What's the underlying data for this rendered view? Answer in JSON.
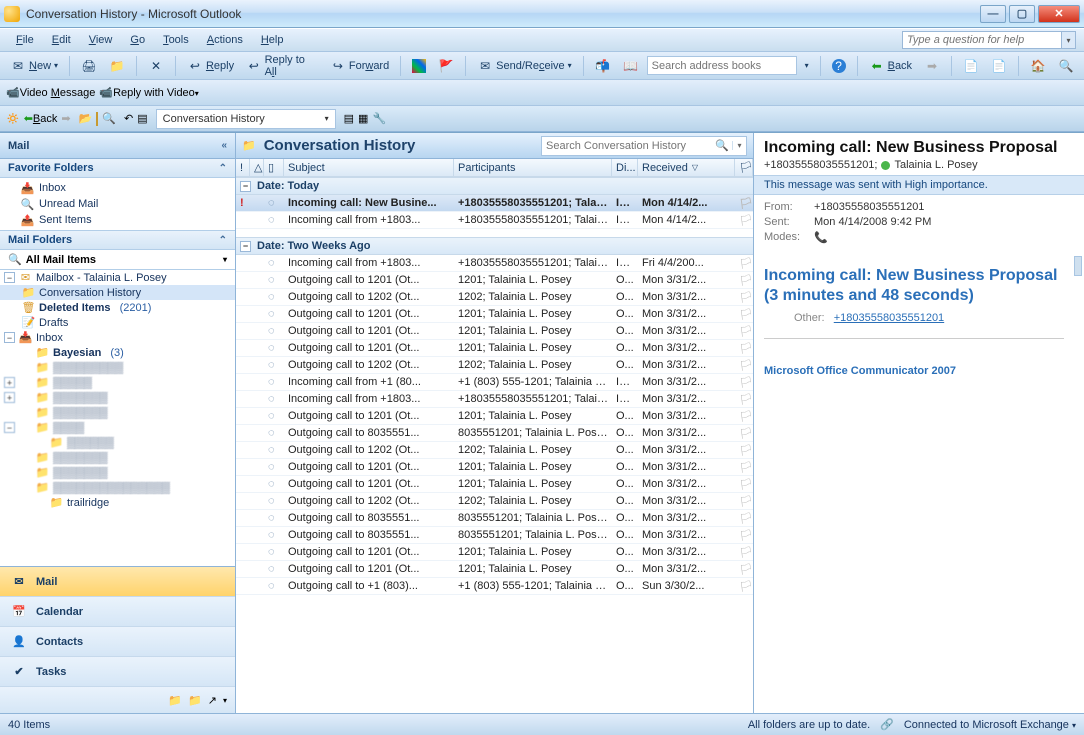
{
  "window": {
    "title": "Conversation History - Microsoft Outlook"
  },
  "menu": {
    "file": "File",
    "edit": "Edit",
    "view": "View",
    "go": "Go",
    "tools": "Tools",
    "actions": "Actions",
    "help": "Help",
    "help_placeholder": "Type a question for help"
  },
  "tb1": {
    "new": "New",
    "reply": "Reply",
    "reply_all": "Reply to All",
    "forward": "Forward",
    "sendrecv": "Send/Receive",
    "search_placeholder": "Search address books",
    "back": "Back"
  },
  "tb2": {
    "video_msg": "Video Message",
    "reply_video": "Reply with Video"
  },
  "tb3": {
    "back": "Back",
    "folder": "Conversation History"
  },
  "nav": {
    "header": "Mail",
    "fav_header": "Favorite Folders",
    "favorites": [
      {
        "label": "Inbox",
        "icon": "inbox"
      },
      {
        "label": "Unread Mail",
        "icon": "search"
      },
      {
        "label": "Sent Items",
        "icon": "sent"
      }
    ],
    "mail_header": "Mail Folders",
    "all_mail": "All Mail Items",
    "mailbox_root": "Mailbox - Talainia L. Posey",
    "conv_hist": "Conversation History",
    "deleted": "Deleted Items",
    "deleted_count": "(2201)",
    "drafts": "Drafts",
    "inbox": "Inbox",
    "bayesian": "Bayesian",
    "bayesian_count": "(3)",
    "trailridge": "trailridge",
    "big": {
      "mail": "Mail",
      "calendar": "Calendar",
      "contacts": "Contacts",
      "tasks": "Tasks"
    }
  },
  "list": {
    "folder_title": "Conversation History",
    "search_placeholder": "Search Conversation History",
    "cols": {
      "subject": "Subject",
      "participants": "Participants",
      "di": "Di...",
      "received": "Received"
    },
    "group_today": "Date: Today",
    "group_twoweeks": "Date: Two Weeks Ago",
    "rows_today": [
      {
        "imp": true,
        "subject": "Incoming call: New Busine...",
        "participants": "+18035558035551201; Talaini...",
        "dir": "In...",
        "received": "Mon 4/14/2...",
        "selected": true,
        "unread": true
      },
      {
        "subject": "Incoming call from +1803...",
        "participants": "+18035558035551201; Talaini...",
        "dir": "In...",
        "received": "Mon 4/14/2..."
      }
    ],
    "rows_twoweeks": [
      {
        "subject": "Incoming call from +1803...",
        "participants": "+18035558035551201; Talaini...",
        "dir": "In...",
        "received": "Fri 4/4/200..."
      },
      {
        "subject": "Outgoing call to 1201 (Ot...",
        "participants": "1201; Talainia L. Posey",
        "dir": "O...",
        "received": "Mon 3/31/2..."
      },
      {
        "subject": "Outgoing call to 1202 (Ot...",
        "participants": "1202; Talainia L. Posey",
        "dir": "O...",
        "received": "Mon 3/31/2..."
      },
      {
        "subject": "Outgoing call to 1201 (Ot...",
        "participants": "1201; Talainia L. Posey",
        "dir": "O...",
        "received": "Mon 3/31/2..."
      },
      {
        "subject": "Outgoing call to 1201 (Ot...",
        "participants": "1201; Talainia L. Posey",
        "dir": "O...",
        "received": "Mon 3/31/2..."
      },
      {
        "subject": "Outgoing call to 1201 (Ot...",
        "participants": "1201; Talainia L. Posey",
        "dir": "O...",
        "received": "Mon 3/31/2..."
      },
      {
        "subject": "Outgoing call to 1202 (Ot...",
        "participants": "1202; Talainia L. Posey",
        "dir": "O...",
        "received": "Mon 3/31/2..."
      },
      {
        "subject": "Incoming call from +1 (80...",
        "participants": "+1 (803) 555-1201; Talainia L...",
        "dir": "In...",
        "received": "Mon 3/31/2..."
      },
      {
        "subject": "Incoming call from +1803...",
        "participants": "+18035558035551201; Talaini...",
        "dir": "In...",
        "received": "Mon 3/31/2..."
      },
      {
        "subject": "Outgoing call to 1201 (Ot...",
        "participants": "1201; Talainia L. Posey",
        "dir": "O...",
        "received": "Mon 3/31/2..."
      },
      {
        "subject": "Outgoing call to 8035551...",
        "participants": "8035551201; Talainia L. Posey",
        "dir": "O...",
        "received": "Mon 3/31/2..."
      },
      {
        "subject": "Outgoing call to 1202 (Ot...",
        "participants": "1202; Talainia L. Posey",
        "dir": "O...",
        "received": "Mon 3/31/2..."
      },
      {
        "subject": "Outgoing call to 1201 (Ot...",
        "participants": "1201; Talainia L. Posey",
        "dir": "O...",
        "received": "Mon 3/31/2..."
      },
      {
        "subject": "Outgoing call to 1201 (Ot...",
        "participants": "1201; Talainia L. Posey",
        "dir": "O...",
        "received": "Mon 3/31/2..."
      },
      {
        "subject": "Outgoing call to 1202 (Ot...",
        "participants": "1202; Talainia L. Posey",
        "dir": "O...",
        "received": "Mon 3/31/2..."
      },
      {
        "subject": "Outgoing call to 8035551...",
        "participants": "8035551201; Talainia L. Posey",
        "dir": "O...",
        "received": "Mon 3/31/2..."
      },
      {
        "subject": "Outgoing call to 8035551...",
        "participants": "8035551201; Talainia L. Posey",
        "dir": "O...",
        "received": "Mon 3/31/2..."
      },
      {
        "subject": "Outgoing call to 1201 (Ot...",
        "participants": "1201; Talainia L. Posey",
        "dir": "O...",
        "received": "Mon 3/31/2..."
      },
      {
        "subject": "Outgoing call to 1201 (Ot...",
        "participants": "1201; Talainia L. Posey",
        "dir": "O...",
        "received": "Mon 3/31/2..."
      },
      {
        "subject": "Outgoing call to +1 (803)...",
        "participants": "+1 (803) 555-1201; Talainia L...",
        "dir": "O...",
        "received": "Sun 3/30/2..."
      }
    ]
  },
  "reading": {
    "title": "Incoming call: New Business Proposal",
    "sub_phone": "+18035558035551201;",
    "sub_name": "Talainia L. Posey",
    "infobar": "This message was sent with High importance.",
    "from_label": "From:",
    "from": "+18035558035551201",
    "sent_label": "Sent:",
    "sent": "Mon 4/14/2008 9:42 PM",
    "modes_label": "Modes:",
    "heading": "Incoming call: New Business Proposal (3 minutes and 48 seconds)",
    "other_label": "Other:",
    "other_link": "+18035558035551201",
    "signature": "Microsoft Office Communicator 2007"
  },
  "status": {
    "items": "40 Items",
    "sync": "All folders are up to date.",
    "conn": "Connected to Microsoft Exchange"
  }
}
